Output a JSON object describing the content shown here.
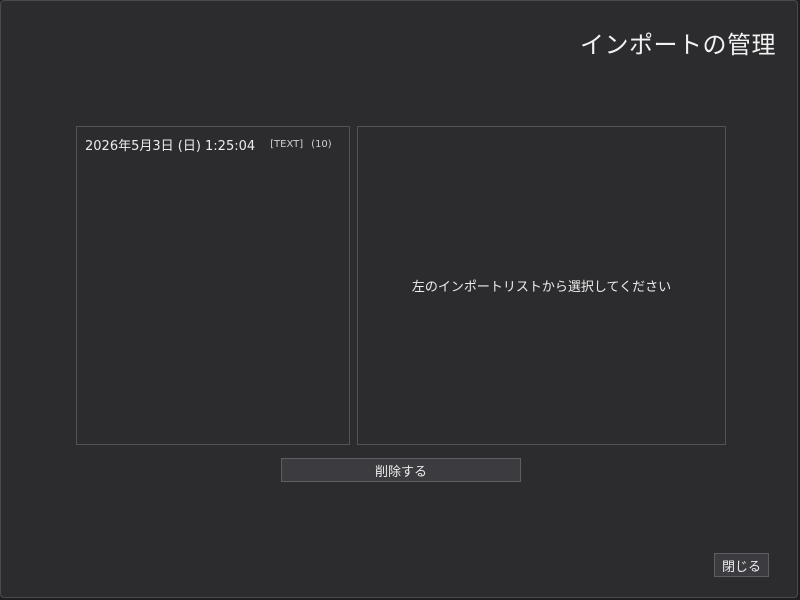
{
  "dialog": {
    "title": "インポートの管理"
  },
  "import_list": {
    "items": [
      {
        "datetime": "2026年5月3日 (日) 1:25:04",
        "type": "[TEXT]",
        "count": "(10)"
      }
    ]
  },
  "detail": {
    "placeholder": "左のインポートリストから選択してください"
  },
  "buttons": {
    "delete_label": "削除する",
    "close_label": "閉じる"
  }
}
